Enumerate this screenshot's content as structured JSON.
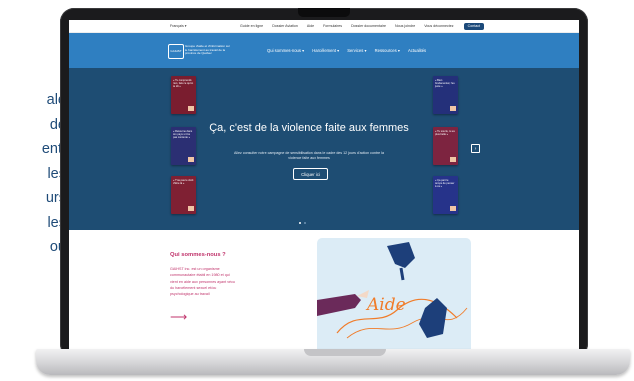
{
  "side_text": [
    "ale",
    "de",
    "ent.",
    "les",
    "urs",
    "les",
    "ou"
  ],
  "site": {
    "topbar": {
      "language": "Français ▾",
      "links": [
        "Guide en ligne",
        "Dossier Aviation",
        "Aide",
        "Formulaires",
        "Dossier documentaire",
        "Nous joindre",
        "Vous déconnectez"
      ],
      "contact_button": "Contact"
    },
    "logo_text": "GAIHST",
    "tagline": "Groupe d'aide et d'information sur le harcèlement au travail de la province de Québec",
    "menu": [
      "Qui sommes-nous ▾",
      "Harcèlement ▾",
      "Services ▾",
      "Ressources ▾",
      "Actualités"
    ],
    "hero": {
      "title": "Ça, c'est de la violence faite aux femmes",
      "subtitle": "Allez consulter notre campagne de sensibilisation dans le cadre des 12 jours d'action contre la violence faite aux femmes",
      "cta_label": "Cliquer ici",
      "next_arrow": "›",
      "books_left": [
        {
          "text": "« Tu comprends rien, fais ce qu'on te dit »",
          "color": "#7a1d2f"
        },
        {
          "text": "« Retourne dans ton pays si t'es pas contente »",
          "color": "#2b2f73"
        },
        {
          "text": "« T'as pas le droit d'être là »",
          "color": "#7f2033"
        }
      ],
      "books_right": [
        {
          "text": "« Bien fondamental, t'es juste »",
          "color": "#24307a"
        },
        {
          "text": "« Tu souris, tu es plus belle »",
          "color": "#7d2440"
        },
        {
          "text": "« Ça part le temps de penser à ca »",
          "color": "#26338a"
        }
      ]
    },
    "about": {
      "title": "Qui sommes-nous ?",
      "body": "GAIHST inc. est un organisme communautaire établi en 1980 et qui vient en aide aux personnes ayant vécu du harcèlement sexuel et/ou psychologique au travail",
      "arrow": "⟶"
    },
    "illustration": {
      "word": "Aide",
      "colors": {
        "background": "#dcecf6",
        "hand_blue": "#1d3f7a",
        "hand_purple": "#6b2a5a",
        "thread": "#f07c2a"
      }
    }
  }
}
